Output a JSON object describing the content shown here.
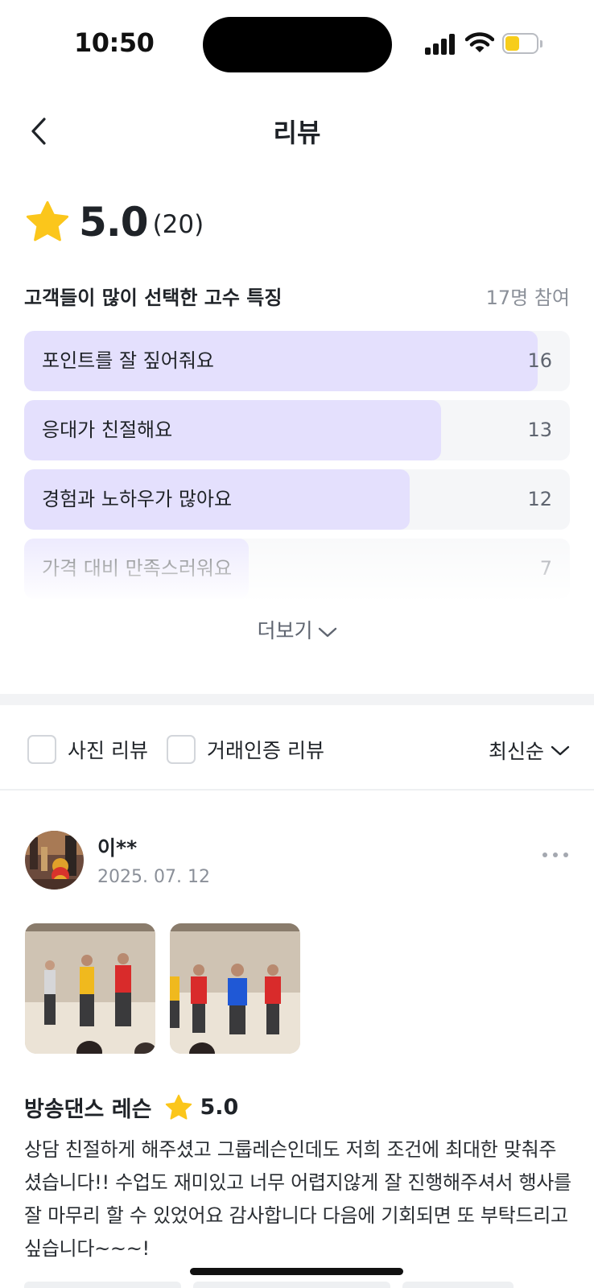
{
  "status_bar": {
    "time": "10:50",
    "battery_level": 0.45,
    "battery_color": "#f7cd1b"
  },
  "header": {
    "back_icon": "chevron-left-icon",
    "title": "리뷰"
  },
  "summary": {
    "star_icon": "star-icon",
    "star_color": "#fbc61b",
    "rating": "5.0",
    "count": "(20)"
  },
  "traits": {
    "title": "고객들이 많이 선택한 고수 특징",
    "participants": "17명 참여",
    "max": 17,
    "items": [
      {
        "label": "포인트를 잘 짚어줘요",
        "count": "16",
        "value": 16
      },
      {
        "label": "응대가 친절해요",
        "count": "13",
        "value": 13
      },
      {
        "label": "경험과 노하우가 많아요",
        "count": "12",
        "value": 12
      },
      {
        "label": "가격 대비 만족스러워요",
        "count": "7",
        "value": 7
      }
    ],
    "more_label": "더보기",
    "more_icon": "chevron-down-icon",
    "fill_color": "#e4e0fd"
  },
  "filters": {
    "photo_review": {
      "label": "사진 리뷰",
      "checked": false
    },
    "verified_review": {
      "label": "거래인증 리뷰",
      "checked": false
    },
    "sort": {
      "label": "최신순",
      "icon": "chevron-down-icon"
    }
  },
  "review": {
    "name": "이**",
    "date": "2025. 07. 12",
    "menu_icon": "more-horizontal-icon",
    "photos": [
      "dance-photo-1",
      "dance-photo-2"
    ],
    "service": "방송댄스 레슨",
    "rating": "5.0",
    "body": "상담 친절하게 해주셨고 그룹레슨인데도 저희 조건에 최대한 맞춰주셨습니다!! 수업도 재미있고 너무 어렵지않게 잘 진행해주셔서 행사를 잘 마무리 할 수 있었어요 감사합니다 다음에 기회되면 또 부탁드리고 싶습니다~~~!"
  }
}
